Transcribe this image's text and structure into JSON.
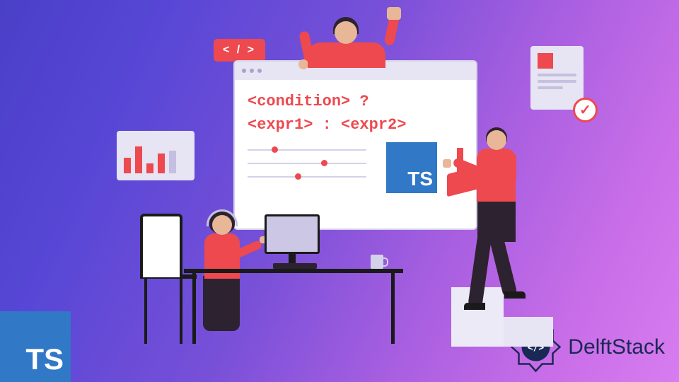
{
  "badges": {
    "ts_corner": "TS",
    "code_tag": "< / >",
    "ts_center": "TS"
  },
  "brand": {
    "name": "DelftStack"
  },
  "code_window": {
    "line1": "<condition> ?",
    "line2": "<expr1> : <expr2>"
  }
}
